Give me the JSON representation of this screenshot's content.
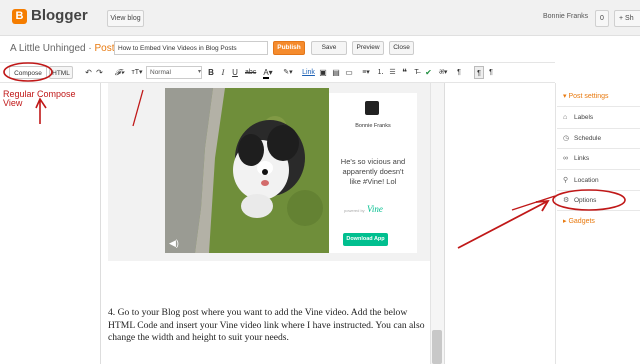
{
  "topbar": {
    "logo_letter": "B",
    "app_name": "Blogger",
    "view_blog": "View blog",
    "user": "Bonnie Franks",
    "notifications": "0",
    "share": "+ Sh"
  },
  "post_header": {
    "blog_title": "A Little Unhinged",
    "separator": " · ",
    "post_word": "Post",
    "title_value": "How to Embed Vine Videos in Blog Posts",
    "publish": "Publish",
    "save": "Save",
    "preview": "Preview",
    "close": "Close"
  },
  "toolbar": {
    "compose": "Compose",
    "html": "HTML",
    "format": "Normal"
  },
  "annotation": {
    "text": "Regular Compose View"
  },
  "vine": {
    "author": "Bonnie Franks",
    "caption": "He's so vicious and apparently doesn't like #Vine! Lol",
    "powered_by": "powered by",
    "brand": "Vine",
    "download": "Download App"
  },
  "body": {
    "step_text": "4. Go to your Blog post where you want to add the Vine video. Add the below HTML Code and insert your Vine video link where I have instructed. You can also change the width and height to suit your needs."
  },
  "right_panel": {
    "post_settings": "Post settings",
    "items": [
      "Labels",
      "Schedule",
      "Links",
      "Location",
      "Options"
    ],
    "gadgets": "Gadgets"
  },
  "colors": {
    "accent": "#f58b2d",
    "annotation_red": "#c01818",
    "vine_green": "#00bf8f"
  }
}
